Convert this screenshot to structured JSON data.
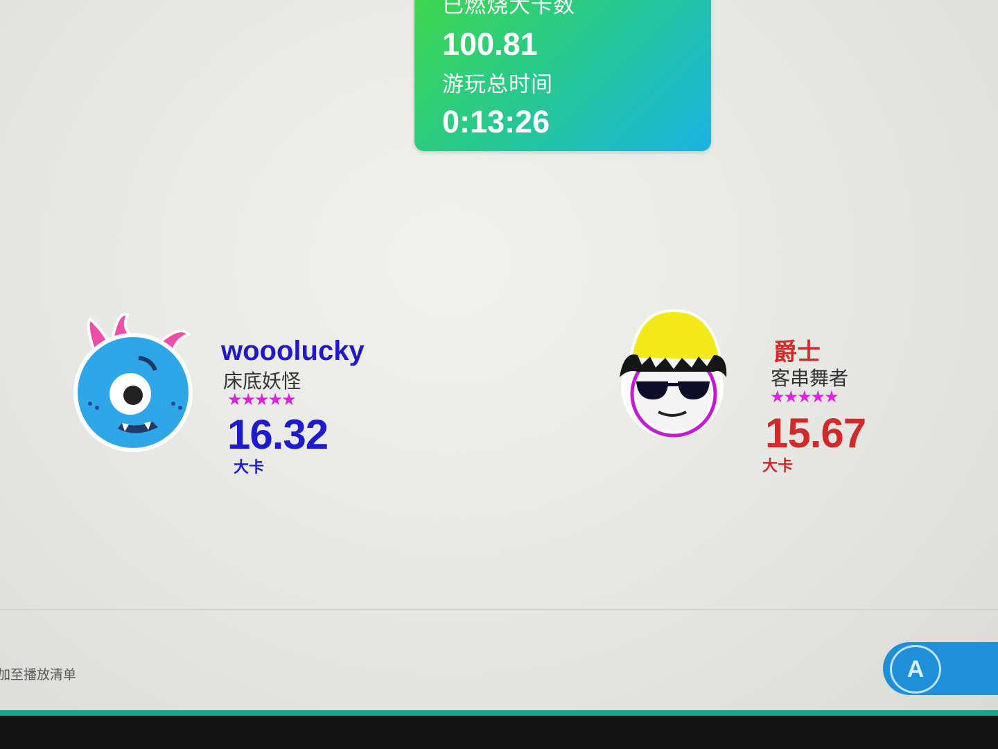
{
  "stats": {
    "calories_label": "已燃烧大卡数",
    "calories_value": "100.81",
    "time_label": "游玩总时间",
    "time_value": "0:13:26"
  },
  "players": [
    {
      "name": "wooolucky",
      "title": "床底妖怪",
      "stars": "★★★★★",
      "star_rating": 5,
      "score": "16.32",
      "unit": "大卡",
      "avatar_icon": "blue-cyclops-monster-icon",
      "color": "#1e1ad0"
    },
    {
      "name": "爵士",
      "title": "客串舞者",
      "stars": "★★★★★",
      "star_rating": 5,
      "score": "15.67",
      "unit": "大卡",
      "avatar_icon": "sunglasses-beanie-face-icon",
      "color": "#d12a2a"
    }
  ],
  "footer": {
    "playlist_hint": "加至播放清单",
    "a_button_label": "A"
  },
  "colors": {
    "panel_gradient_start": "#3fd84c",
    "panel_gradient_end": "#1ab4e4",
    "star": "#e020e0",
    "a_button": "#1e8fd8"
  }
}
